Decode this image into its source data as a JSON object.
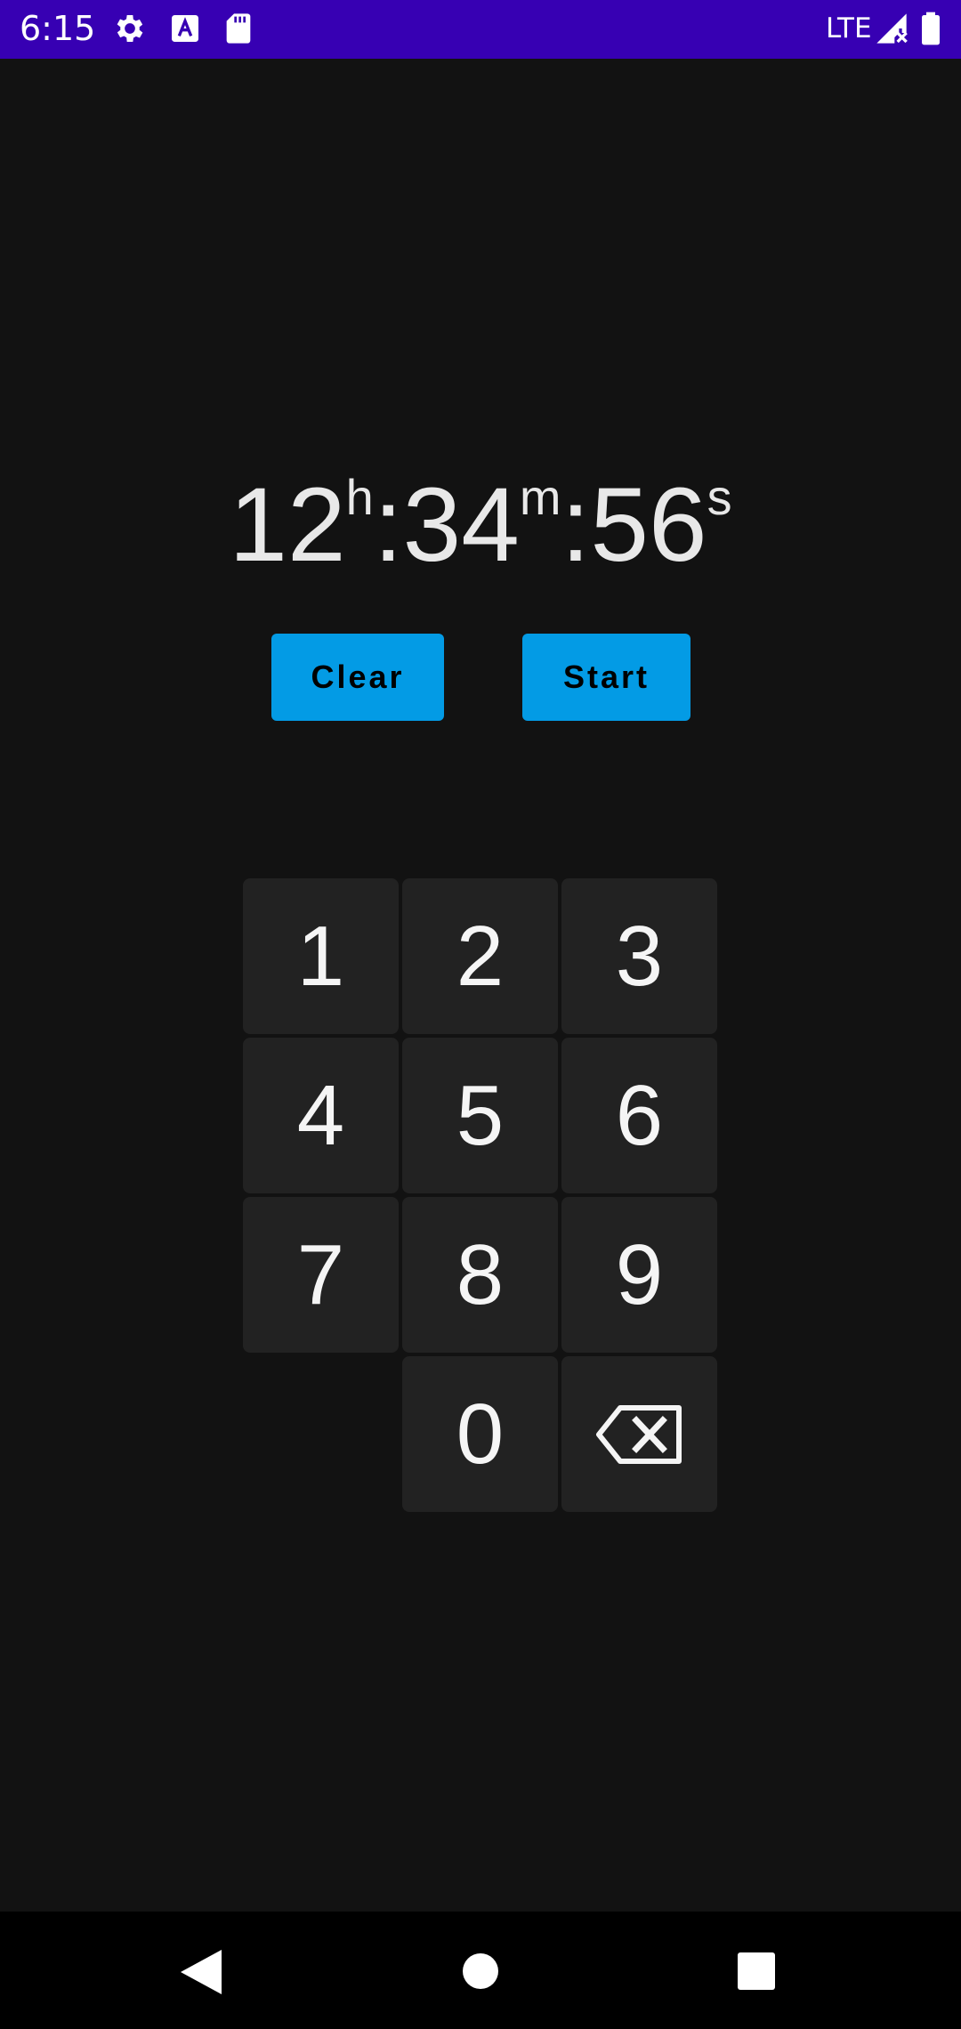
{
  "status_bar": {
    "time": "6:15",
    "network": "LTE",
    "icons": [
      "gear-icon",
      "a-notification-icon",
      "sd-card-icon",
      "signal-icon",
      "battery-icon"
    ]
  },
  "timer": {
    "hours": "12",
    "hours_unit": "h",
    "separator": ":",
    "minutes": "34",
    "minutes_unit": "m",
    "seconds": "56",
    "seconds_unit": "s"
  },
  "actions": {
    "clear_label": "Clear",
    "start_label": "Start"
  },
  "keypad": {
    "keys": [
      "1",
      "2",
      "3",
      "4",
      "5",
      "6",
      "7",
      "8",
      "9",
      "0"
    ],
    "backspace_icon": "backspace-icon"
  },
  "navigation": {
    "icons": [
      "back-icon",
      "home-icon",
      "recents-icon"
    ]
  },
  "colors": {
    "status_bar": "#3700b3",
    "background": "#121212",
    "button": "#039be5",
    "key": "#222222"
  }
}
